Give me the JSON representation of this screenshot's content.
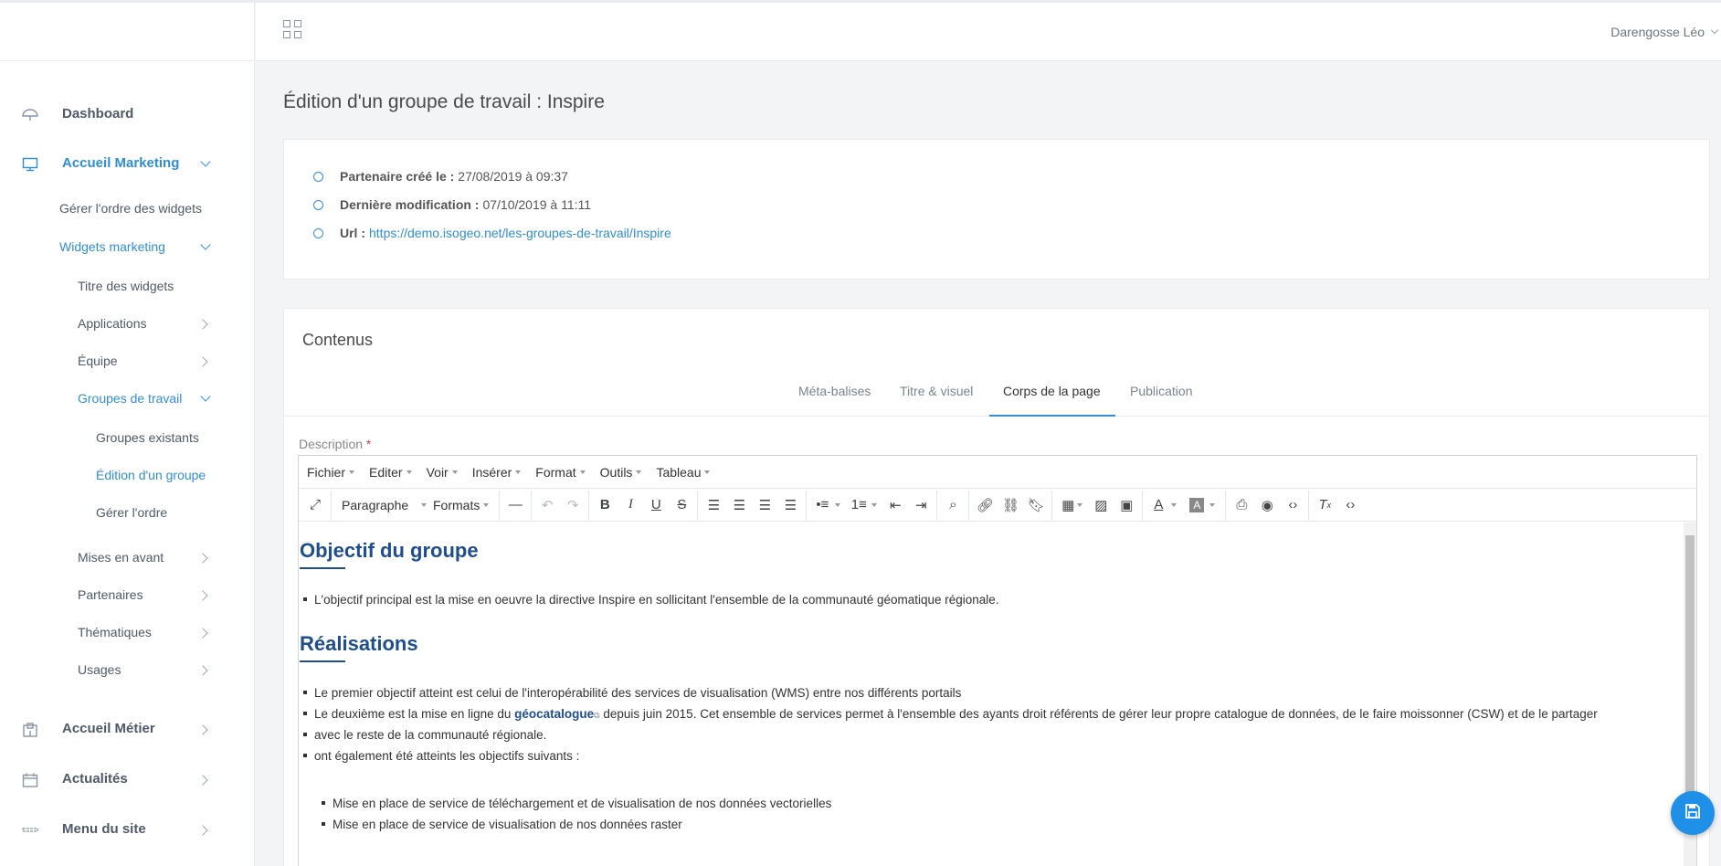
{
  "header": {
    "user_name": "Darengosse Léo"
  },
  "sidebar": {
    "items": [
      {
        "label": "Dashboard",
        "icon": "umbrella-icon"
      },
      {
        "label": "Accueil Marketing",
        "icon": "monitor-icon"
      },
      {
        "label": "Gérer l'ordre des widgets"
      },
      {
        "label": "Widgets marketing"
      },
      {
        "label": "Titre des widgets"
      },
      {
        "label": "Applications"
      },
      {
        "label": "Équipe"
      },
      {
        "label": "Groupes de travail"
      },
      {
        "label": "Groupes existants"
      },
      {
        "label": "Édition d'un groupe"
      },
      {
        "label": "Gérer l'ordre"
      },
      {
        "label": "Mises en avant"
      },
      {
        "label": "Partenaires"
      },
      {
        "label": "Thématiques"
      },
      {
        "label": "Usages"
      },
      {
        "label": "Accueil Métier",
        "icon": "building-icon"
      },
      {
        "label": "Actualités",
        "icon": "calendar-icon"
      },
      {
        "label": "Menu du site",
        "icon": "menu-icon"
      }
    ],
    "accent_color": "#2f8fd6"
  },
  "page": {
    "title": "Édition d'un groupe de travail : Inspire"
  },
  "info": {
    "created_label": "Partenaire créé le :",
    "created_value": "27/08/2019 à 09:37",
    "modified_label": "Dernière modification :",
    "modified_value": "07/10/2019 à 11:11",
    "url_label": "Url :",
    "url_value": "https://demo.isogeo.net/les-groupes-de-travail/Inspire"
  },
  "content": {
    "title": "Contenus",
    "tabs": [
      "Méta-balises",
      "Titre & visuel",
      "Corps de la page",
      "Publication"
    ],
    "active_tab": "Corps de la page",
    "description_label": "Description",
    "required_mark": "*"
  },
  "editor": {
    "menu": [
      "Fichier",
      "Editer",
      "Voir",
      "Insérer",
      "Format",
      "Outils",
      "Tableau"
    ],
    "block_format": "Paragraphe",
    "formats_label": "Formats",
    "doc": {
      "h1": "Objectif du groupe",
      "p1": "L'objectif principal est la mise en oeuvre la directive Inspire en sollicitant l'ensemble de la communauté géomatique régionale.",
      "h2": "Réalisations",
      "r1": "Le premier objectif atteint est celui de l'interopérabilité des services de visualisation (WMS) entre nos différents portails",
      "r2_before": "Le deuxième est la mise en ligne du ",
      "r2_link": "géocatalogue",
      "r2_after": " depuis juin 2015. Cet ensemble de services permet à l'ensemble des ayants droit référents de gérer leur propre catalogue de données, de le faire moissonner (CSW) et de le partager",
      "r2_cont": "avec le reste de la communauté régionale.",
      "r3": "ont également été atteints les objectifs suivants :",
      "s1": "Mise en place de service de téléchargement et de visualisation de nos données vectorielles",
      "s2": "Mise en place de service de visualisation de nos données raster"
    }
  }
}
